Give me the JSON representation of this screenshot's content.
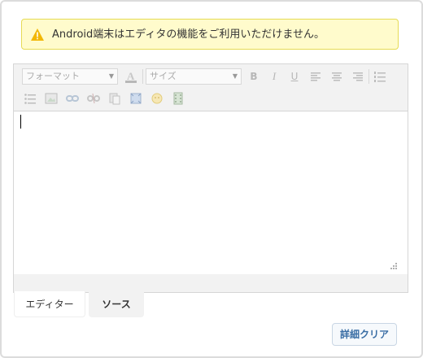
{
  "warning": {
    "icon": "warning-icon",
    "message": "Android端末はエディタの機能をご利用いただけません。",
    "bg_color": "#fffbcc",
    "border_color": "#e6db55"
  },
  "toolbar": {
    "format_select": "フォーマット",
    "size_select": "サイズ",
    "row1_icons": [
      "font-color-icon",
      "bold-icon",
      "italic-icon",
      "underline-icon",
      "align-left-icon",
      "align-center-icon",
      "align-right-icon",
      "numbered-list-icon"
    ],
    "row2_icons": [
      "bullet-list-icon",
      "image-icon",
      "link-icon",
      "unlink-icon",
      "paste-icon",
      "fullscreen-icon",
      "smiley-icon",
      "media-icon"
    ],
    "bold_label": "B",
    "italic_label": "I",
    "underline_label": "U"
  },
  "tabs": {
    "editor": "エディター",
    "source": "ソース"
  },
  "buttons": {
    "clear": "詳細クリア"
  }
}
